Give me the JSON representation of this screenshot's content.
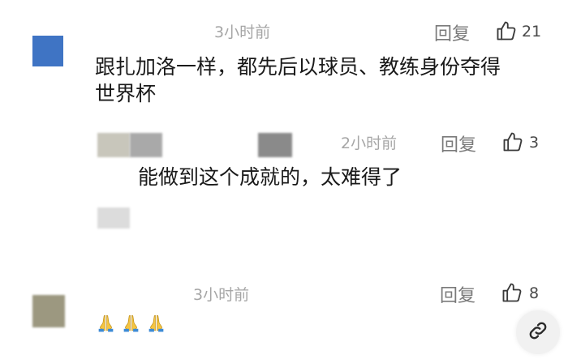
{
  "comments": [
    {
      "time": "3小时前",
      "reply_label": "回复",
      "likes": "21",
      "text_line1": "跟扎加洛一样，都先后以球员、教练身份夺得",
      "text_line2": "世界杯",
      "avatar_color": "#3f74c4"
    },
    {
      "time": "2小时前",
      "reply_label": "回复",
      "likes": "3",
      "text": "能做到这个成就的，太难得了"
    },
    {
      "time": "3小时前",
      "reply_label": "回复",
      "likes": "8",
      "emojis": [
        "folded-hands",
        "folded-hands",
        "folded-hands"
      ]
    }
  ],
  "icons": {
    "like": "thumbs-up-icon",
    "share_link": "link-icon"
  },
  "colors": {
    "meta_gray": "#a6a6a6",
    "reply_gray": "#7a7a7a",
    "text": "#1a1a1a"
  }
}
